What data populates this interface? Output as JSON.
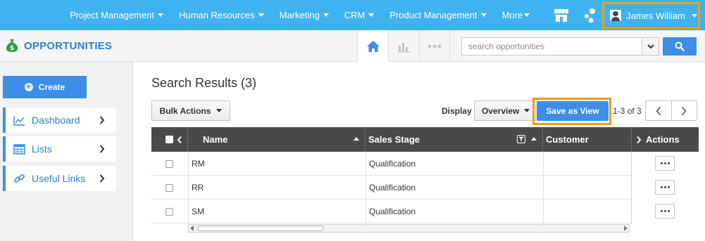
{
  "topnav": {
    "menu": [
      {
        "label": "Project Management",
        "has_dropdown": true
      },
      {
        "label": "Human Resources",
        "has_dropdown": true
      },
      {
        "label": "Marketing",
        "has_dropdown": true
      },
      {
        "label": "CRM",
        "has_dropdown": true
      },
      {
        "label": "Product Management",
        "has_dropdown": true
      },
      {
        "label": "More",
        "has_dropdown": true
      }
    ],
    "icons": [
      "store-icon",
      "network-icon"
    ],
    "user_name": "James William",
    "color": "#3fb2f0"
  },
  "subheader": {
    "module_title": "OPPORTUNITIES",
    "module_icon": "money-bag-icon",
    "view_tabs": [
      "home-icon",
      "bar-chart-icon",
      "more-dots-icon"
    ],
    "search_placeholder": "search opportunities"
  },
  "sidebar": {
    "create_label": "Create",
    "items": [
      {
        "label": "Dashboard",
        "icon": "line-chart-icon"
      },
      {
        "label": "Lists",
        "icon": "table-icon"
      },
      {
        "label": "Useful Links",
        "icon": "link-icon"
      }
    ]
  },
  "main": {
    "results_title": "Search Results (3)",
    "bulk_actions_label": "Bulk Actions",
    "display_label": "Display",
    "display_value": "Overview",
    "save_view_label": "Save as View",
    "page_count": "1-3 of 3",
    "accent": "#3d8ee9",
    "highlight": "#f39c12"
  },
  "table": {
    "columns": [
      "Name",
      "Sales Stage",
      "Customer",
      "Actions"
    ],
    "rows": [
      {
        "name": "RM",
        "sales_stage": "Qualification",
        "customer": ""
      },
      {
        "name": "RR",
        "sales_stage": "Qualification",
        "customer": ""
      },
      {
        "name": "SM",
        "sales_stage": "Qualification",
        "customer": ""
      }
    ]
  }
}
